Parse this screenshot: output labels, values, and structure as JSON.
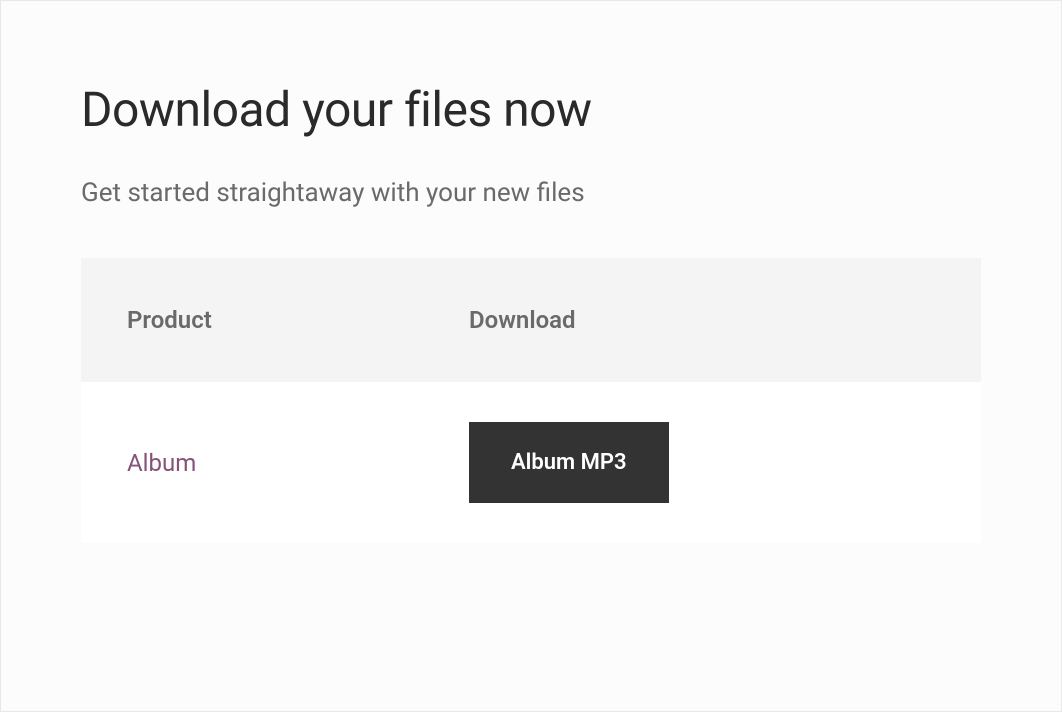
{
  "header": {
    "title": "Download your files now",
    "subtitle": "Get started straightaway with your new files"
  },
  "table": {
    "columns": {
      "product": "Product",
      "download": "Download"
    },
    "rows": [
      {
        "product_name": "Album",
        "download_label": "Album MP3"
      }
    ]
  }
}
